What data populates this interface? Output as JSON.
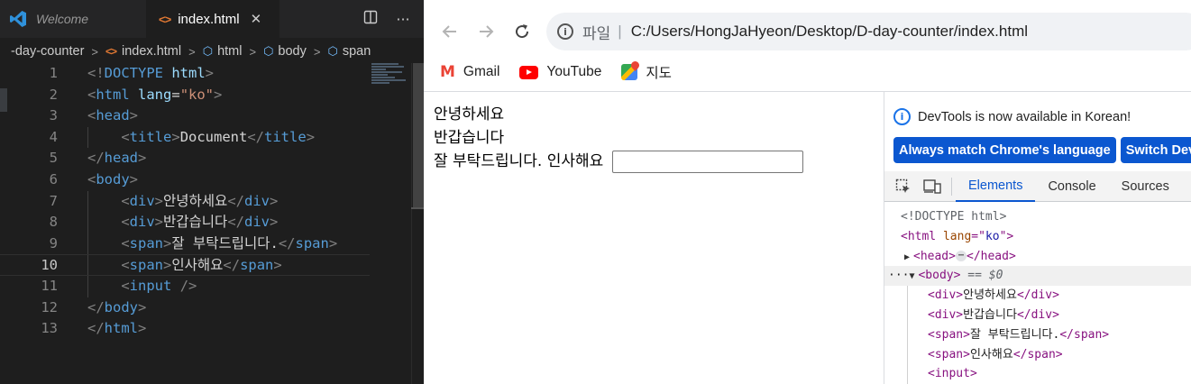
{
  "vscode": {
    "tabs": [
      {
        "label": "Welcome",
        "icon": "vscode-logo-icon"
      },
      {
        "label": "index.html",
        "icon": "html-file-icon",
        "close": "✕"
      }
    ],
    "tab_action_icons": [
      "split-editor-icon",
      "more-actions-icon"
    ],
    "breadcrumb": [
      "-day-counter",
      "index.html",
      "html",
      "body",
      "span"
    ],
    "active_line": 10,
    "lines": [
      {
        "n": 1,
        "tokens": [
          [
            "t",
            "<!"
          ],
          [
            "tag",
            "DOCTYPE"
          ],
          [
            "txt",
            " "
          ],
          [
            "attr",
            "html"
          ],
          [
            "t",
            ">"
          ]
        ]
      },
      {
        "n": 2,
        "tokens": [
          [
            "t",
            "<"
          ],
          [
            "tag",
            "html"
          ],
          [
            "txt",
            " "
          ],
          [
            "attr",
            "lang"
          ],
          [
            "txt",
            "="
          ],
          [
            "str",
            "\"ko\""
          ],
          [
            "t",
            ">"
          ]
        ]
      },
      {
        "n": 3,
        "tokens": [
          [
            "t",
            "<"
          ],
          [
            "tag",
            "head"
          ],
          [
            "t",
            ">"
          ]
        ]
      },
      {
        "n": 4,
        "indent": true,
        "tokens": [
          [
            "txt",
            "    "
          ],
          [
            "t",
            "<"
          ],
          [
            "tag",
            "title"
          ],
          [
            "t",
            ">"
          ],
          [
            "txt",
            "Document"
          ],
          [
            "t",
            "</"
          ],
          [
            "tag",
            "title"
          ],
          [
            "t",
            ">"
          ]
        ]
      },
      {
        "n": 5,
        "tokens": [
          [
            "t",
            "</"
          ],
          [
            "tag",
            "head"
          ],
          [
            "t",
            ">"
          ]
        ]
      },
      {
        "n": 6,
        "tokens": [
          [
            "t",
            "<"
          ],
          [
            "tag",
            "body"
          ],
          [
            "t",
            ">"
          ]
        ]
      },
      {
        "n": 7,
        "indent": true,
        "tokens": [
          [
            "txt",
            "    "
          ],
          [
            "t",
            "<"
          ],
          [
            "tag",
            "div"
          ],
          [
            "t",
            ">"
          ],
          [
            "txt",
            "안녕하세요"
          ],
          [
            "t",
            "</"
          ],
          [
            "tag",
            "div"
          ],
          [
            "t",
            ">"
          ]
        ]
      },
      {
        "n": 8,
        "indent": true,
        "tokens": [
          [
            "txt",
            "    "
          ],
          [
            "t",
            "<"
          ],
          [
            "tag",
            "div"
          ],
          [
            "t",
            ">"
          ],
          [
            "txt",
            "반갑습니다"
          ],
          [
            "t",
            "</"
          ],
          [
            "tag",
            "div"
          ],
          [
            "t",
            ">"
          ]
        ]
      },
      {
        "n": 9,
        "indent": true,
        "tokens": [
          [
            "txt",
            "    "
          ],
          [
            "t",
            "<"
          ],
          [
            "tag",
            "span"
          ],
          [
            "t",
            ">"
          ],
          [
            "txt",
            "잘 부탁드립니다."
          ],
          [
            "t",
            "</"
          ],
          [
            "tag",
            "span"
          ],
          [
            "t",
            ">"
          ]
        ]
      },
      {
        "n": 10,
        "indent": true,
        "tokens": [
          [
            "txt",
            "    "
          ],
          [
            "t",
            "<"
          ],
          [
            "tag",
            "span"
          ],
          [
            "t",
            ">"
          ],
          [
            "txt",
            "인사해요"
          ],
          [
            "t",
            "</"
          ],
          [
            "tag",
            "span"
          ],
          [
            "t",
            ">"
          ]
        ]
      },
      {
        "n": 11,
        "indent": true,
        "tokens": [
          [
            "txt",
            "    "
          ],
          [
            "t",
            "<"
          ],
          [
            "tag",
            "input"
          ],
          [
            "txt",
            " "
          ],
          [
            "t",
            "/>"
          ]
        ]
      },
      {
        "n": 12,
        "tokens": [
          [
            "t",
            "</"
          ],
          [
            "tag",
            "body"
          ],
          [
            "t",
            ">"
          ]
        ]
      },
      {
        "n": 13,
        "tokens": [
          [
            "t",
            "</"
          ],
          [
            "tag",
            "html"
          ],
          [
            "t",
            ">"
          ]
        ]
      }
    ]
  },
  "chrome": {
    "omnibox": {
      "label": "파일",
      "separator": "|",
      "url": "C:/Users/HongJaHyeon/Desktop/D-day-counter/index.html"
    },
    "bookmarks": [
      {
        "label": "Gmail",
        "icon": "gmail-icon"
      },
      {
        "label": "YouTube",
        "icon": "youtube-icon"
      },
      {
        "label": "지도",
        "icon": "maps-icon"
      }
    ],
    "page": {
      "line1": "안녕하세요",
      "line2": "반갑습니다",
      "span1": "잘 부탁드립니다.",
      "span2": "인사해요"
    },
    "devtools": {
      "notice": "DevTools is now available in Korean!",
      "buttons": [
        "Always match Chrome's language",
        "Switch DevTo"
      ],
      "tabs": [
        "Elements",
        "Console",
        "Sources"
      ],
      "active_tab": "Elements",
      "dom": [
        {
          "kind": "doc",
          "indent": 0,
          "text": "<!DOCTYPE html>"
        },
        {
          "kind": "open",
          "indent": 0,
          "tag": "html",
          "attr": "lang",
          "val": "ko"
        },
        {
          "kind": "collapsed",
          "indent": 0,
          "tag": "head",
          "ellipsis": "⋯"
        },
        {
          "kind": "body",
          "indent": 0,
          "tag": "body",
          "marker": "== $0",
          "dots": "···"
        },
        {
          "kind": "elem",
          "indent": 1,
          "tag": "div",
          "text": "안녕하세요"
        },
        {
          "kind": "elem",
          "indent": 1,
          "tag": "div",
          "text": "반갑습니다"
        },
        {
          "kind": "elem",
          "indent": 1,
          "tag": "span",
          "text": "잘 부탁드립니다."
        },
        {
          "kind": "elem",
          "indent": 1,
          "tag": "span",
          "text": "인사해요"
        },
        {
          "kind": "void",
          "indent": 1,
          "tag": "input"
        }
      ]
    }
  }
}
